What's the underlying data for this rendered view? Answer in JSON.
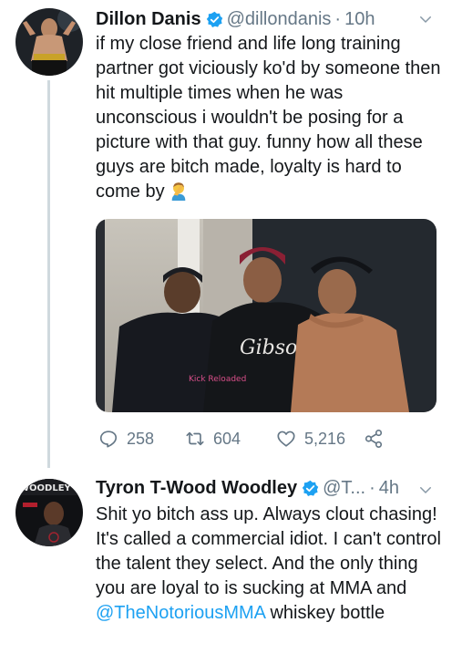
{
  "tweets": [
    {
      "author_name": "Dillon Danis",
      "handle": "@dillondanis",
      "separator": "·",
      "time": "10h",
      "text": "if my close friend and life long training partner got viciously ko'd by someone then hit multiple times when he was unconscious i wouldn't be posing for a picture with that guy. funny how all these guys are bitch made, loyalty is hard to come by",
      "emoji": "man-facepalming-emoji",
      "photo_text": "Gibson",
      "shirt_text": "Kick Reloaded",
      "stats": {
        "replies": "258",
        "retweets": "604",
        "likes": "5,216"
      }
    },
    {
      "author_name": "Tyron T-Wood Woodley",
      "handle": "@T...",
      "separator": "·",
      "time": "4h",
      "avatar_text": "WOODLEY",
      "text_part1": "Shit yo bitch ass up. Always clout chasing! It's called a commercial idiot. I can't control the talent they select. And the only thing you are loyal to is sucking at MMA and ",
      "mention": "@TheNotoriousMMA",
      "text_part2": " whiskey bottle"
    }
  ],
  "colors": {
    "accent": "#1da1f2",
    "secondary_text": "#657786",
    "thread_line": "#cfd9de"
  }
}
